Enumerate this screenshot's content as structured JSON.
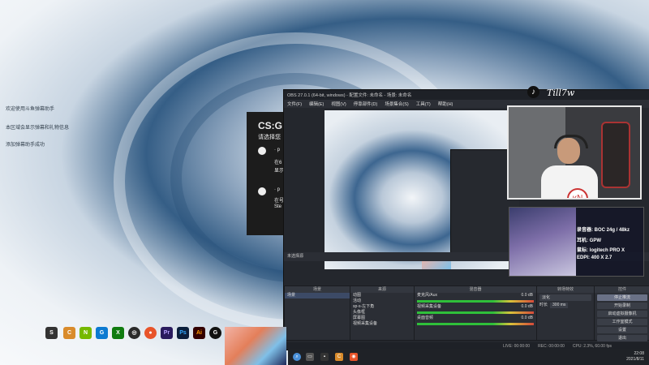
{
  "desktop": {
    "lines": [
      "欢迎使用斗鱼弹幕助手",
      "本区域会显示弹幕和礼物信息",
      "添加弹幕助手成功"
    ]
  },
  "background_dialog": {
    "title": "CS:G",
    "subtitle": "请选择您",
    "option1_line1": "· p",
    "option1_line2": "在6",
    "option1_line3": "显示",
    "option2_line1": "· p",
    "option2_line2": "在号",
    "option2_line3": "Ste"
  },
  "obs": {
    "title": "OBS 27.0.1 (64-bit, windows) - 配置文件: 未命名 - 场景: 未命名",
    "menu": [
      "文件(F)",
      "编辑(E)",
      "视图(V)",
      "停靠部件(D)",
      "场景集合(S)",
      "工具(T)",
      "帮助(H)"
    ],
    "no_source": "未选择源",
    "docks": {
      "scenes": {
        "title": "场景",
        "items": [
          "场景"
        ]
      },
      "sources": {
        "title": "来源",
        "items": [
          "动图",
          "活动",
          "sp-s-左下角",
          "头像框",
          "屏幕图",
          "视频采集设备"
        ]
      },
      "mixer": {
        "title": "混音器",
        "channels": [
          {
            "name": "麦克风/Aux",
            "db": "0.0 dB"
          },
          {
            "name": "视频采集设备",
            "db": "0.0 dB"
          },
          {
            "name": "桌面音频",
            "db": "0.0 dB"
          }
        ]
      },
      "transitions": {
        "title": "转场特效",
        "type": "淡化",
        "duration_label": "时长",
        "duration": "300 ms"
      },
      "controls": {
        "title": "控件",
        "buttons": [
          "停止推流",
          "开始录制",
          "启动虚拟摄像机",
          "工作室模式",
          "设置",
          "退出"
        ]
      }
    },
    "status": {
      "live": "LIVE: 00:00:00",
      "rec": "REC: 00:00:00",
      "cpu": "CPU: 2.3%, 60.00 fps"
    }
  },
  "overlay": {
    "tiktok_name": "Till7w",
    "spec_lines": [
      "录音器: BOC 24g / 48kz",
      "耳机: GPW",
      "鼠标: logitech PRO X",
      "EDPI: 400 X 2.7"
    ]
  },
  "taskbar": {
    "icons": [
      "steam",
      "cs-go",
      "nvidia",
      "g-hub",
      "xbox",
      "obs",
      "record",
      "premiere",
      "photoshop",
      "illustrator",
      "logitech"
    ],
    "clock_time": "22:08",
    "clock_date": "2021/8/11"
  },
  "colors": {
    "obs_bg": "#24272d",
    "obs_panel": "#2b2e35",
    "meter_green": "#2fbf3a",
    "selection": "#3c4a66"
  }
}
